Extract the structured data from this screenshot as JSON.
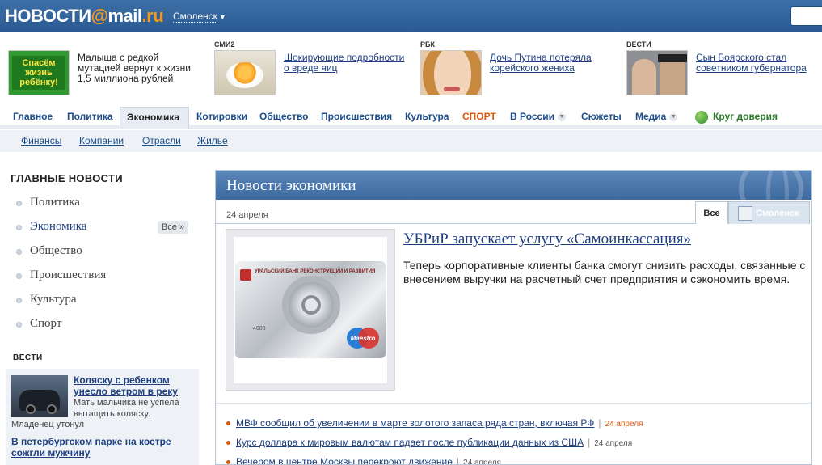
{
  "header": {
    "logo_left": "НОВОСТИ",
    "logo_at": "@",
    "logo_mail": "mail",
    "logo_dot": ".",
    "logo_ru": "ru",
    "region": "Смоленск",
    "colors": {
      "bar": "#2f5f98",
      "accent": "#f39a1e"
    }
  },
  "teasers": [
    {
      "source": "",
      "text": "Малыша с редкой мутацией вернут к жизни 1,5 миллиона рублей",
      "image_text": "Спасём жизнь ребёнку!"
    },
    {
      "source": "СМИ2",
      "text": "Шокирующие подробности о вреде яиц"
    },
    {
      "source": "РБК",
      "text": "Дочь Путина потеряла корейского жениха"
    },
    {
      "source": "ВЕСТИ",
      "text": "Сын Боярского стал советником губернатора"
    }
  ],
  "nav": {
    "items": [
      {
        "label": "Главное"
      },
      {
        "label": "Политика"
      },
      {
        "label": "Экономика"
      },
      {
        "label": "Котировки"
      },
      {
        "label": "Общество"
      },
      {
        "label": "Происшествия"
      },
      {
        "label": "Культура"
      },
      {
        "label": "СПОРТ"
      },
      {
        "label": "В России"
      },
      {
        "label": "Сюжеты"
      },
      {
        "label": "Медиа"
      },
      {
        "label": "Круг доверия"
      }
    ],
    "active_index": 2
  },
  "subnav": {
    "items": [
      "Финансы",
      "Компании",
      "Отрасли",
      "Жилье"
    ]
  },
  "sidebar": {
    "title": "ГЛАВНЫЕ НОВОСТИ",
    "items": [
      {
        "label": "Политика"
      },
      {
        "label": "Экономика"
      },
      {
        "label": "Общество"
      },
      {
        "label": "Происшествия"
      },
      {
        "label": "Культура"
      },
      {
        "label": "Спорт"
      }
    ],
    "all_label": "Все »",
    "vesti_logo": "ВЕСТИ",
    "vesti_news": [
      {
        "title": "Коляску с ребенком унесло ветром в реку",
        "text": "Мать мальчика не успела вытащить коляску.",
        "extra": "Младенец утонул"
      },
      {
        "title": "В петербургском парке на костре сожгли мужчину",
        "text": ""
      }
    ]
  },
  "economy": {
    "title": "Новости экономики",
    "date": "24 апреля",
    "tabs": [
      "Все",
      "Смоленск"
    ],
    "featured": {
      "title": "УБРиР запускает услугу «Самоинкассация»",
      "description": "Теперь корпоративные клиенты банка смогут снизить расходы, связанные с внесением выручки на расчетный счет предприятия и сэкономить время.",
      "card_bank": "УРАЛЬСКИЙ БАНК РЕКОНСТРУКЦИИ И РАЗВИТИЯ",
      "card_number": "4000",
      "card_brand": "Maestro"
    },
    "news": [
      {
        "title": "МВФ сообщил об увеличении в марте золотого запаса ряда стран, включая РФ",
        "date": "24 апреля"
      },
      {
        "title": "Курс доллара к мировым валютам падает после публикации данных из США",
        "date": "24 апреля"
      },
      {
        "title": "Вечером в центре Москвы перекроют движение",
        "date": "24 апреля"
      }
    ]
  }
}
